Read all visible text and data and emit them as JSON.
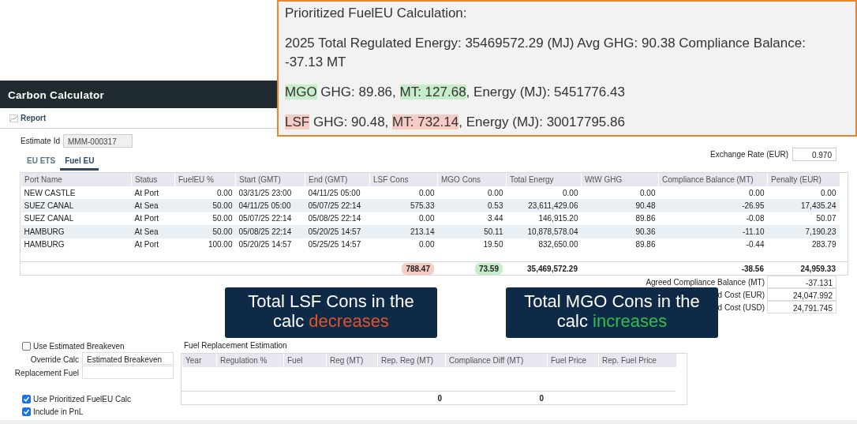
{
  "banner": {
    "title": "Prioritized FuelEU Calculation:",
    "summary": "2025 Total Regulated Energy: 35469572.29 (MJ) Avg GHG: 90.38 Compliance Balance: -37.13 MT",
    "fuels": [
      [
        {
          "text": "MGO",
          "color": "#c7ecc9"
        },
        {
          "text": " GHG: 89.86, "
        },
        {
          "text": "MT: 127.68",
          "color": "#c7ecc9"
        },
        {
          "text": ", Energy (MJ): 5451776.43"
        }
      ],
      [
        {
          "text": "LSF",
          "color": "#f6cbc3"
        },
        {
          "text": " GHG: 90.48, "
        },
        {
          "text": "MT: 732.14",
          "color": "#f6cbc3"
        },
        {
          "text": ", Energy (MJ): 30017795.86"
        }
      ]
    ]
  },
  "header": {
    "title": "Carbon Calculator"
  },
  "toolbar": {
    "report": "Report"
  },
  "estimate": {
    "label": "Estimate Id",
    "value": "MMM-000317"
  },
  "exchange_rate": {
    "label": "Exchange Rate (EUR)",
    "value": "0.970"
  },
  "tabs": [
    {
      "label": "EU ETS",
      "selected": false
    },
    {
      "label": "Fuel EU",
      "selected": true
    }
  ],
  "table": {
    "columns": [
      "Port Name",
      "Status",
      "FuelEU %",
      "Start (GMT)",
      "End (GMT)",
      "LSF Cons",
      "MGO Cons",
      "Total Energy",
      "WtW GHG",
      "Compliance Balance (MT)",
      "Penalty (EUR)"
    ],
    "rows": [
      [
        "NEW CASTLE",
        "At Port",
        "0.00",
        "03/31/25 23:00",
        "04/11/25 05:00",
        "0.00",
        "0.00",
        "0.00",
        "0.00",
        "0.00",
        "0.00"
      ],
      [
        "SUEZ CANAL",
        "At Sea",
        "50.00",
        "04/11/25 05:00",
        "05/07/25 22:14",
        "575.33",
        "0.53",
        "23,611,429.06",
        "90.48",
        "-26.95",
        "17,435.24"
      ],
      [
        "SUEZ CANAL",
        "At Port",
        "50.00",
        "05/07/25 22:14",
        "05/08/25 22:14",
        "0.00",
        "3.44",
        "146,915.20",
        "89.86",
        "-0.08",
        "50.07"
      ],
      [
        "HAMBURG",
        "At Sea",
        "50.00",
        "05/08/25 22:14",
        "05/20/25 14:57",
        "213.14",
        "50.11",
        "10,878,578.04",
        "90.36",
        "-11.10",
        "7,190.23"
      ],
      [
        "HAMBURG",
        "At Port",
        "100.00",
        "05/20/25 14:57",
        "05/25/25 14:57",
        "0.00",
        "19.50",
        "832,650.00",
        "89.86",
        "-0.44",
        "283.79"
      ]
    ],
    "totals": {
      "lsf_cons": {
        "text": "788.47",
        "color": "#f6cbc3"
      },
      "mgo_cons": {
        "text": "73.59",
        "color": "#c7ecc9"
      },
      "total_energy": {
        "text": "35,469,572.29"
      },
      "compliance_balance": {
        "text": "-38.56"
      },
      "penalty": {
        "text": "24,959.33"
      }
    }
  },
  "summary": [
    {
      "label": "Agreed Compliance Balance (MT)",
      "value": "-37.131"
    },
    {
      "label": "d Cost (EUR)",
      "value": "24,047.992"
    },
    {
      "label": "d Cost (USD)",
      "value": "24,791.745"
    }
  ],
  "callouts": [
    {
      "segments": [
        {
          "text": "Total LSF Cons in the calc "
        },
        {
          "text": "decreases",
          "color": "#e0532a"
        }
      ]
    },
    {
      "segments": [
        {
          "text": "Total MGO Cons in the calc "
        },
        {
          "text": "increases",
          "color": "#2fbf4a"
        }
      ]
    }
  ],
  "breakeven": {
    "label": "Use Estimated Breakeven",
    "checked": false
  },
  "override": {
    "label": "Override Calc",
    "value": "Estimated Breakeven"
  },
  "replacement_fuel": {
    "label": "Replacement Fuel"
  },
  "options": [
    {
      "label": "Use Prioritized FuelEU Calc",
      "checked": true
    },
    {
      "label": "Include in PnL",
      "checked": true
    }
  ],
  "replacement": {
    "title": "Fuel Replacement Estimation",
    "columns": [
      "Year",
      "Regulation %",
      "Fuel",
      "Reg (MT)",
      "Rep. Reg (MT)",
      "Compliance Diff (MT)",
      "Fuel Price",
      "Rep. Fuel Price"
    ],
    "totals": {
      "rep_reg": "0",
      "compliance_diff": "0"
    }
  }
}
